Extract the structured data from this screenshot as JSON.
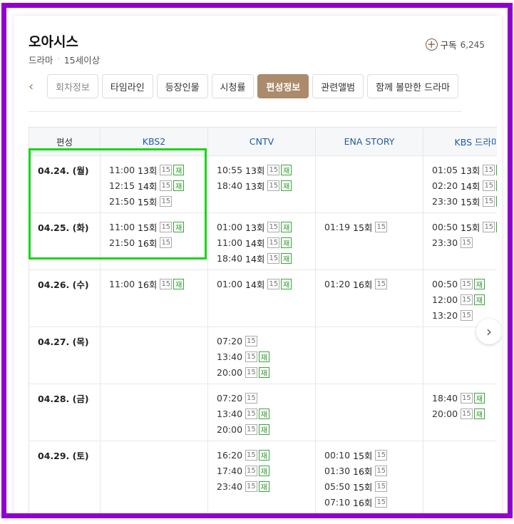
{
  "header": {
    "title": "오아시스",
    "genre": "드라마",
    "age": "15세이상",
    "subscribe_label": "구독",
    "subscribe_count": "6,245"
  },
  "tabs": [
    {
      "label": "회차정보",
      "active": false
    },
    {
      "label": "타임라인",
      "active": false
    },
    {
      "label": "등장인물",
      "active": false
    },
    {
      "label": "시청률",
      "active": false
    },
    {
      "label": "편성정보",
      "active": true
    },
    {
      "label": "관련앨범",
      "active": false
    },
    {
      "label": "함께 볼만한 드라마",
      "active": false
    }
  ],
  "schedule": {
    "columns": [
      "편성",
      "KBS2",
      "CNTV",
      "ENA STORY",
      "KBS 드라마"
    ],
    "rows": [
      {
        "date": "04.24. (월)",
        "channels": [
          [
            {
              "time": "11:00",
              "ep": "13회",
              "rating": "15",
              "rerun": "재"
            },
            {
              "time": "12:15",
              "ep": "14회",
              "rating": "15",
              "rerun": "재"
            },
            {
              "time": "21:50",
              "ep": "15회",
              "rating": "15",
              "rerun": ""
            }
          ],
          [
            {
              "time": "10:55",
              "ep": "13회",
              "rating": "15",
              "rerun": "재"
            },
            {
              "time": "18:40",
              "ep": "13회",
              "rating": "15",
              "rerun": "재"
            }
          ],
          [],
          [
            {
              "time": "01:05",
              "ep": "13회",
              "rating": "15",
              "rerun": "재"
            },
            {
              "time": "02:20",
              "ep": "14회",
              "rating": "15",
              "rerun": "재"
            },
            {
              "time": "23:30",
              "ep": "15회",
              "rating": "15",
              "rerun": "재"
            }
          ]
        ]
      },
      {
        "date": "04.25. (화)",
        "channels": [
          [
            {
              "time": "11:00",
              "ep": "15회",
              "rating": "15",
              "rerun": "재"
            },
            {
              "time": "21:50",
              "ep": "16회",
              "rating": "15",
              "rerun": ""
            }
          ],
          [
            {
              "time": "01:00",
              "ep": "13회",
              "rating": "15",
              "rerun": "재"
            },
            {
              "time": "11:00",
              "ep": "14회",
              "rating": "15",
              "rerun": "재"
            },
            {
              "time": "18:40",
              "ep": "14회",
              "rating": "15",
              "rerun": "재"
            }
          ],
          [
            {
              "time": "01:19",
              "ep": "15회",
              "rating": "15",
              "rerun": ""
            }
          ],
          [
            {
              "time": "00:50",
              "ep": "15회",
              "rating": "15",
              "rerun": "재"
            },
            {
              "time": "23:30",
              "ep": "",
              "rating": "15",
              "rerun": ""
            }
          ]
        ]
      },
      {
        "date": "04.26. (수)",
        "channels": [
          [
            {
              "time": "11:00",
              "ep": "16회",
              "rating": "15",
              "rerun": "재"
            }
          ],
          [
            {
              "time": "01:00",
              "ep": "14회",
              "rating": "15",
              "rerun": "재"
            }
          ],
          [
            {
              "time": "01:20",
              "ep": "16회",
              "rating": "15",
              "rerun": ""
            }
          ],
          [
            {
              "time": "00:50",
              "ep": "",
              "rating": "15",
              "rerun": "재"
            },
            {
              "time": "12:00",
              "ep": "",
              "rating": "15",
              "rerun": "재"
            },
            {
              "time": "13:20",
              "ep": "",
              "rating": "15",
              "rerun": ""
            }
          ]
        ]
      },
      {
        "date": "04.27. (목)",
        "channels": [
          [],
          [
            {
              "time": "07:20",
              "ep": "",
              "rating": "15",
              "rerun": ""
            },
            {
              "time": "13:40",
              "ep": "",
              "rating": "15",
              "rerun": "재"
            },
            {
              "time": "20:00",
              "ep": "",
              "rating": "15",
              "rerun": "재"
            }
          ],
          [],
          []
        ]
      },
      {
        "date": "04.28. (금)",
        "channels": [
          [],
          [
            {
              "time": "07:20",
              "ep": "",
              "rating": "15",
              "rerun": ""
            },
            {
              "time": "13:40",
              "ep": "",
              "rating": "15",
              "rerun": "재"
            },
            {
              "time": "20:00",
              "ep": "",
              "rating": "15",
              "rerun": "재"
            }
          ],
          [],
          [
            {
              "time": "18:40",
              "ep": "",
              "rating": "15",
              "rerun": "재"
            },
            {
              "time": "20:00",
              "ep": "",
              "rating": "15",
              "rerun": "재"
            }
          ]
        ]
      },
      {
        "date": "04.29. (토)",
        "channels": [
          [],
          [
            {
              "time": "16:20",
              "ep": "",
              "rating": "15",
              "rerun": "재"
            },
            {
              "time": "17:40",
              "ep": "",
              "rating": "15",
              "rerun": "재"
            },
            {
              "time": "23:40",
              "ep": "",
              "rating": "15",
              "rerun": "재"
            }
          ],
          [
            {
              "time": "00:10",
              "ep": "15회",
              "rating": "15",
              "rerun": ""
            },
            {
              "time": "01:30",
              "ep": "16회",
              "rating": "15",
              "rerun": ""
            },
            {
              "time": "05:50",
              "ep": "15회",
              "rating": "15",
              "rerun": ""
            },
            {
              "time": "07:10",
              "ep": "16회",
              "rating": "15",
              "rerun": ""
            }
          ],
          []
        ]
      }
    ]
  },
  "colors": {
    "frame": "#8f00d0",
    "active_tab": "#ab8b6b",
    "highlight": "#13d813",
    "channel_text": "#1f5aa8",
    "rerun": "#2a942a"
  },
  "icons": {
    "subscribe": "plus-circle-icon",
    "tabs_prev": "chevron-left-icon",
    "table_next": "chevron-right-icon"
  }
}
